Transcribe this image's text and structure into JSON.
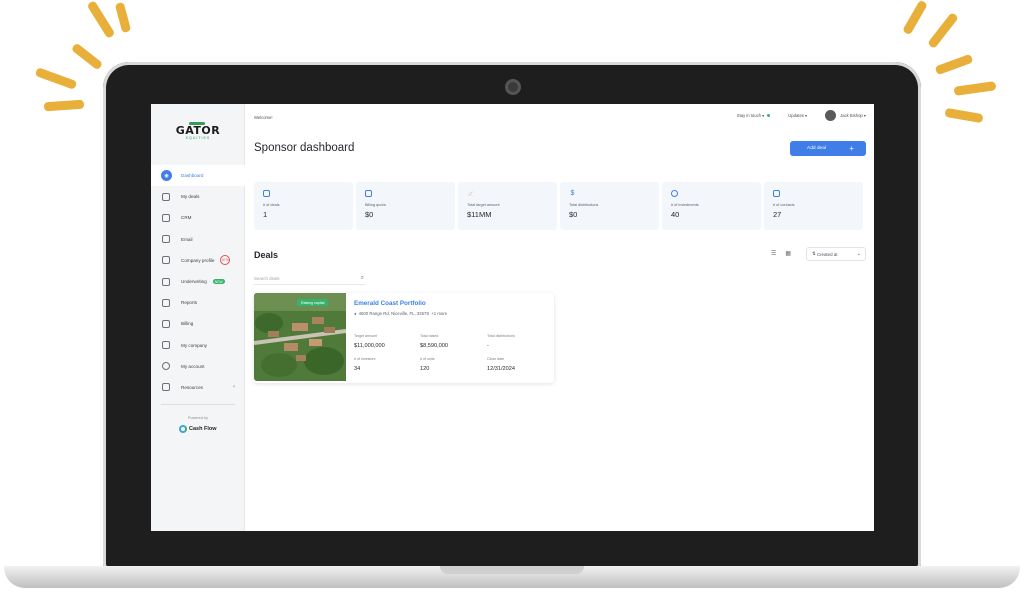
{
  "brand": {
    "name": "GATOR",
    "sub": "EQUITIES"
  },
  "sidebar": {
    "items": [
      {
        "label": "Dashboard",
        "icon": "dashboard-icon",
        "active": true
      },
      {
        "label": "My deals",
        "icon": "deals-icon"
      },
      {
        "label": "CRM",
        "icon": "crm-icon"
      },
      {
        "label": "Email",
        "icon": "mail-icon"
      },
      {
        "label": "Company profile",
        "icon": "profile-icon",
        "badge": "67%"
      },
      {
        "label": "Underwriting",
        "icon": "underwriting-icon",
        "badge": "NEW"
      },
      {
        "label": "Reports",
        "icon": "reports-icon"
      },
      {
        "label": "Billing",
        "icon": "billing-icon"
      },
      {
        "label": "My company",
        "icon": "company-icon"
      },
      {
        "label": "My account",
        "icon": "gear-icon"
      },
      {
        "label": "Resources",
        "icon": "resources-icon"
      }
    ],
    "powered_by": "Powered by",
    "powered_logo": "Cash Flow"
  },
  "header": {
    "welcome": "Welcome!",
    "stay_in_touch": "Stay in touch",
    "updates": "Updates",
    "user_name": "Jack Bishop"
  },
  "page": {
    "title": "Sponsor dashboard",
    "add_deal": "Add deal"
  },
  "stats": [
    {
      "label": "# of deals",
      "value": "1",
      "icon": "clipboard-icon"
    },
    {
      "label": "Billing quota",
      "value": "$0",
      "icon": "calendar-icon"
    },
    {
      "label": "Total target amount",
      "value": "$11MM",
      "icon": "chart-icon"
    },
    {
      "label": "Total distributions",
      "value": "$0",
      "icon": "dollar-icon"
    },
    {
      "label": "# of investments",
      "value": "40",
      "icon": "user-icon"
    },
    {
      "label": "# of contacts",
      "value": "27",
      "icon": "contacts-icon"
    }
  ],
  "deals": {
    "title": "Deals",
    "search_placeholder": "Search deals",
    "sort_label": "Created at",
    "card": {
      "tag": "Raising capital",
      "name": "Emerald Coast Portfolio",
      "address": "4600 Range Rd, Niceville, FL, 32578",
      "more": "+1 more",
      "fields": [
        {
          "label": "Target amount",
          "value": "$11,000,000"
        },
        {
          "label": "Total raised",
          "value": "$8,590,000"
        },
        {
          "label": "Total distributions",
          "value": "-"
        },
        {
          "label": "# of investors",
          "value": "34"
        },
        {
          "label": "# of units",
          "value": "120"
        },
        {
          "label": "Close date",
          "value": "12/31/2024"
        }
      ]
    }
  },
  "colors": {
    "accent": "#3f7ee8",
    "green": "#37b26c",
    "ray": "#e8b03a"
  }
}
